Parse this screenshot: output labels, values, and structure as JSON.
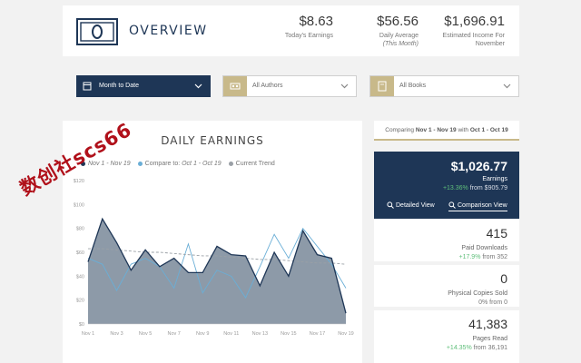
{
  "header": {
    "title": "OVERVIEW",
    "today": {
      "value": "$8.63",
      "label": "Today's Earnings"
    },
    "avg": {
      "value": "$56.56",
      "label": "Daily Average",
      "sublabel": "(This Month)"
    },
    "income": {
      "value": "$1,696.91",
      "label": "Estimated Income For",
      "sublabel": "November"
    }
  },
  "filters": {
    "date": "Month to Date",
    "authors": "All Authors",
    "books": "All Books"
  },
  "chart": {
    "title": "DAILY EARNINGS",
    "legend_current": "Nov 1 - Nov 19",
    "legend_compare_prefix": "Compare to: ",
    "legend_compare_range": "Oct 1 - Oct 19",
    "legend_trend": "Current Trend"
  },
  "chart_data": {
    "type": "area",
    "title": "DAILY EARNINGS",
    "x": [
      "Nov 1",
      "Nov 2",
      "Nov 3",
      "Nov 4",
      "Nov 5",
      "Nov 6",
      "Nov 7",
      "Nov 8",
      "Nov 9",
      "Nov 10",
      "Nov 11",
      "Nov 12",
      "Nov 13",
      "Nov 14",
      "Nov 15",
      "Nov 16",
      "Nov 17",
      "Nov 18",
      "Nov 19"
    ],
    "tick_labels": [
      "Nov 1",
      "Nov 3",
      "Nov 5",
      "Nov 7",
      "Nov 9",
      "Nov 11",
      "Nov 13",
      "Nov 15",
      "Nov 17",
      "Nov 19"
    ],
    "ylim": [
      0,
      120
    ],
    "yticks": [
      "$0",
      "$20",
      "$40",
      "$60",
      "$80",
      "$100",
      "$120"
    ],
    "grid": false,
    "legend_position": "top-left",
    "series": [
      {
        "name": "Nov 1 - Nov 19",
        "values": [
          52,
          88,
          68,
          45,
          62,
          48,
          55,
          43,
          43,
          65,
          58,
          57,
          32,
          60,
          40,
          78,
          58,
          55,
          9
        ],
        "color": "#1e3656"
      },
      {
        "name": "Oct 1 - Oct 19",
        "values": [
          55,
          50,
          28,
          50,
          55,
          48,
          30,
          67,
          26,
          45,
          40,
          22,
          48,
          75,
          55,
          80,
          65,
          50,
          30
        ],
        "color": "#6aaed6"
      },
      {
        "name": "Current Trend",
        "values": [
          63,
          63,
          62,
          61,
          60,
          60,
          59,
          58,
          57,
          57,
          56,
          55,
          54,
          54,
          53,
          52,
          51,
          51,
          50
        ],
        "color": "#9aa0a6"
      }
    ],
    "colors": {
      "area_fill": "#8d9aa8"
    }
  },
  "compare": {
    "prefix": "Comparing ",
    "current": "Nov 1 - Nov 19",
    "middle": " with ",
    "previous": "Oct 1 - Oct 19"
  },
  "earnings": {
    "value": "$1,026.77",
    "label": "Earnings",
    "change_pct": "+13.36%",
    "from_text": " from $905.79",
    "detailed": "Detailed View",
    "comparison": "Comparison View"
  },
  "metrics": {
    "downloads": {
      "value": "415",
      "label": "Paid Downloads",
      "change_pct": "+17.9%",
      "from_text": " from 352"
    },
    "copies": {
      "value": "0",
      "label": "Physical Copies Sold",
      "change_text": "0% from 0"
    },
    "pages": {
      "value": "41,383",
      "label": "Pages Read",
      "change_pct": "+14.35%",
      "from_text": " from 36,191"
    }
  },
  "watermark": "数创社scs66",
  "colors": {
    "navy": "#1e3656",
    "gold": "#c8b98a",
    "positive": "#5fbf7a"
  }
}
